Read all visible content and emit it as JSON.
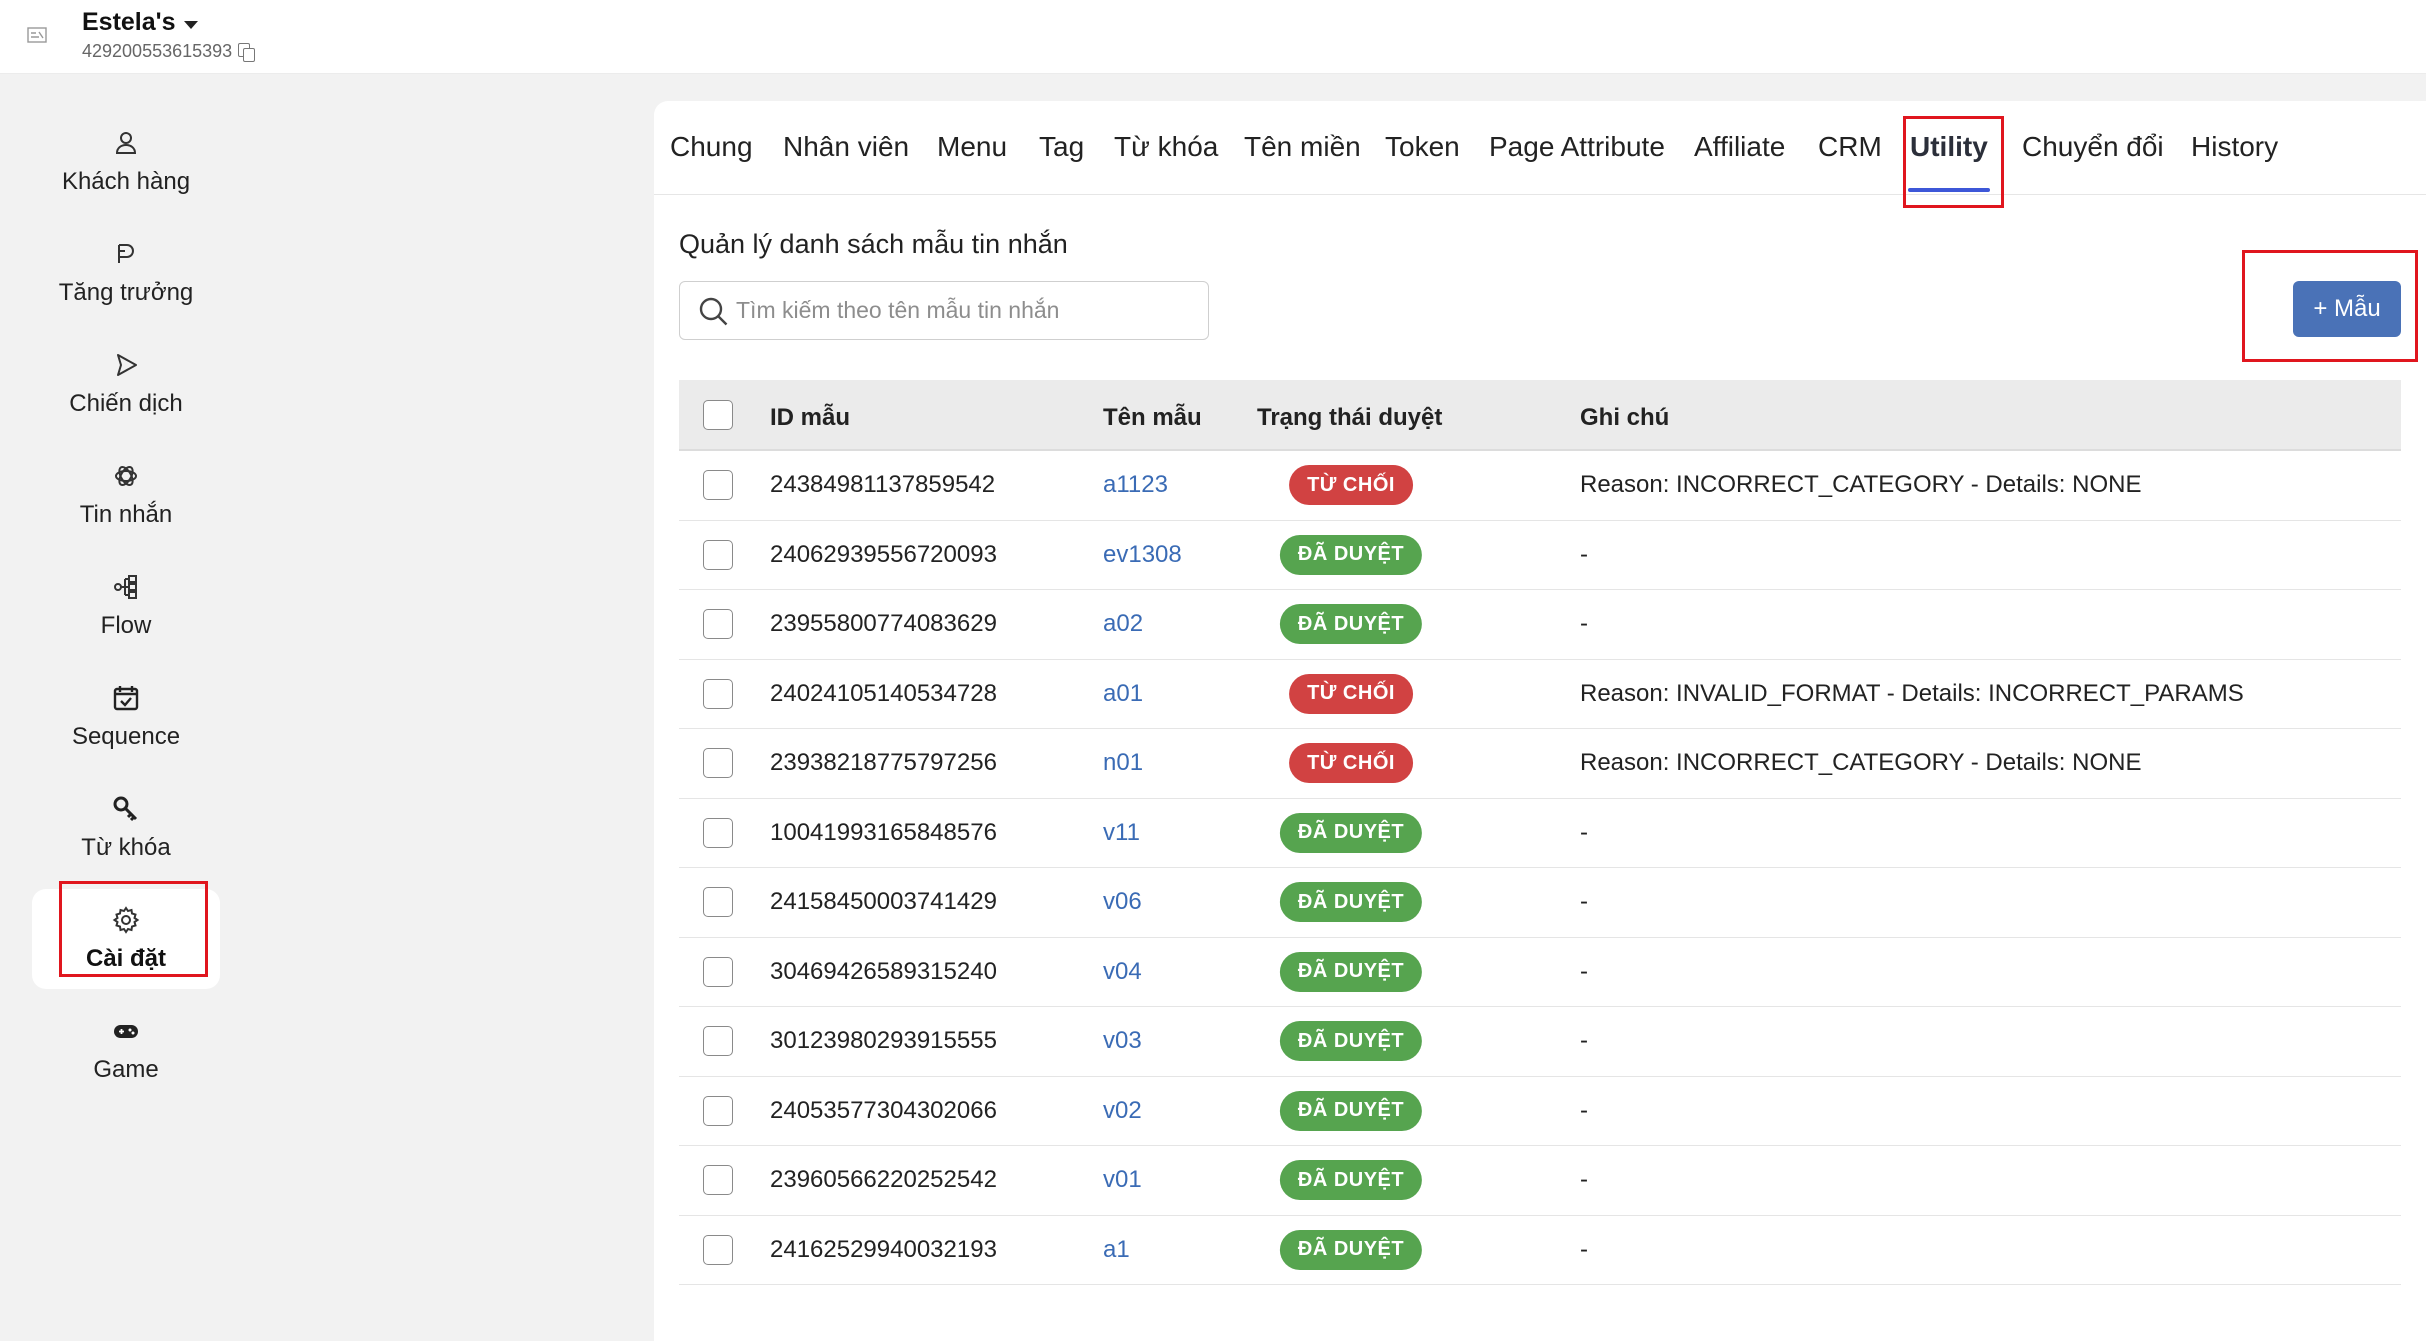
{
  "header": {
    "account_name": "Estela's",
    "account_id": "429200553615393",
    "logo_icon": "app-logo-icon"
  },
  "sidebar": {
    "items": [
      {
        "label": "Khách hàng",
        "icon": "user-icon"
      },
      {
        "label": "Tăng trưởng",
        "icon": "growth-icon"
      },
      {
        "label": "Chiến dịch",
        "icon": "send-icon"
      },
      {
        "label": "Tin nhắn",
        "icon": "message-icon"
      },
      {
        "label": "Flow",
        "icon": "flow-icon"
      },
      {
        "label": "Sequence",
        "icon": "calendar-check-icon"
      },
      {
        "label": "Từ khóa",
        "icon": "key-icon"
      },
      {
        "label": "Cài đặt",
        "icon": "gear-icon",
        "active": true
      },
      {
        "label": "Game",
        "icon": "gamepad-icon"
      }
    ]
  },
  "tabs": [
    {
      "label": "Chung"
    },
    {
      "label": "Nhân viên"
    },
    {
      "label": "Menu"
    },
    {
      "label": "Tag"
    },
    {
      "label": "Từ khóa"
    },
    {
      "label": "Tên miền"
    },
    {
      "label": "Token"
    },
    {
      "label": "Page Attribute"
    },
    {
      "label": "Affiliate"
    },
    {
      "label": "CRM"
    },
    {
      "label": "Utility",
      "active": true
    },
    {
      "label": "Chuyển đổi"
    },
    {
      "label": "History"
    }
  ],
  "main": {
    "title": "Quản lý danh sách mẫu tin nhắn",
    "search_placeholder": "Tìm kiếm theo tên mẫu tin nhắn",
    "search_value": "",
    "add_button": "+ Mẫu"
  },
  "table": {
    "columns": [
      "ID mẫu",
      "Tên mẫu",
      "Trạng thái duyệt",
      "Ghi chú"
    ],
    "rows": [
      {
        "id": "24384981137859542",
        "name": "a1123",
        "status": "TỪ CHỐI",
        "status_type": "rejected",
        "note": "Reason: INCORRECT_CATEGORY - Details: NONE"
      },
      {
        "id": "24062939556720093",
        "name": "ev1308",
        "status": "ĐÃ DUYỆT",
        "status_type": "approved",
        "note": "-"
      },
      {
        "id": "23955800774083629",
        "name": "a02",
        "status": "ĐÃ DUYỆT",
        "status_type": "approved",
        "note": "-"
      },
      {
        "id": "24024105140534728",
        "name": "a01",
        "status": "TỪ CHỐI",
        "status_type": "rejected",
        "note": "Reason: INVALID_FORMAT - Details: INCORRECT_PARAMS"
      },
      {
        "id": "23938218775797256",
        "name": "n01",
        "status": "TỪ CHỐI",
        "status_type": "rejected",
        "note": "Reason: INCORRECT_CATEGORY - Details: NONE"
      },
      {
        "id": "10041993165848576",
        "name": "v11",
        "status": "ĐÃ DUYỆT",
        "status_type": "approved",
        "note": "-"
      },
      {
        "id": "24158450003741429",
        "name": "v06",
        "status": "ĐÃ DUYỆT",
        "status_type": "approved",
        "note": "-"
      },
      {
        "id": "30469426589315240",
        "name": "v04",
        "status": "ĐÃ DUYỆT",
        "status_type": "approved",
        "note": "-"
      },
      {
        "id": "30123980293915555",
        "name": "v03",
        "status": "ĐÃ DUYỆT",
        "status_type": "approved",
        "note": "-"
      },
      {
        "id": "24053577304302066",
        "name": "v02",
        "status": "ĐÃ DUYỆT",
        "status_type": "approved",
        "note": "-"
      },
      {
        "id": "23960566220252542",
        "name": "v01",
        "status": "ĐÃ DUYỆT",
        "status_type": "approved",
        "note": "-"
      },
      {
        "id": "24162529940032193",
        "name": "a1",
        "status": "ĐÃ DUYỆT",
        "status_type": "approved",
        "note": "-"
      }
    ]
  },
  "colors": {
    "accent": "#3d57d8",
    "button": "#4a72b7",
    "link": "#3a6bb5",
    "rejected": "#d14242",
    "approved": "#56a44f",
    "highlight": "#e0161e"
  }
}
